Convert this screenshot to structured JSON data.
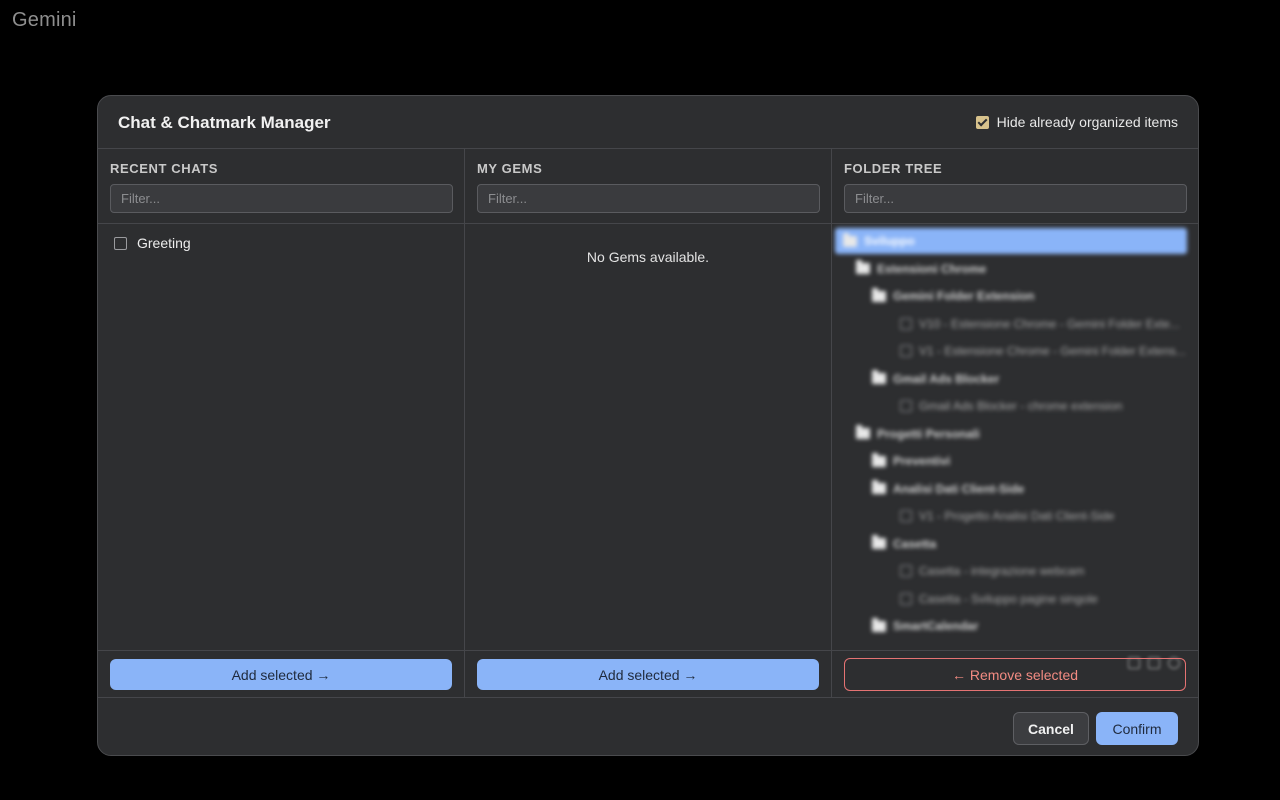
{
  "app": {
    "title": "Gemini"
  },
  "modal": {
    "title": "Chat & Chatmark Manager",
    "hide_organized_label": "Hide already organized items",
    "hide_organized_checked": true,
    "accent_color": "#8ab4f8",
    "danger_color": "#f28b82",
    "checkbox_color": "#d7c28c"
  },
  "recent_chats": {
    "title": "RECENT CHATS",
    "filter_placeholder": "Filter...",
    "items": [
      {
        "label": "Greeting",
        "checked": false
      }
    ],
    "add_button_label": "Add selected →"
  },
  "my_gems": {
    "title": "MY GEMS",
    "filter_placeholder": "Filter...",
    "empty_message": "No Gems available.",
    "add_button_label": "Add selected →"
  },
  "folder_tree": {
    "title": "FOLDER TREE",
    "filter_placeholder": "Filter...",
    "remove_button_label": "← Remove selected",
    "rows": [
      {
        "type": "folder",
        "label": "Sviluppo",
        "level": 0,
        "selected": true
      },
      {
        "type": "folder",
        "label": "Estensioni Chrome",
        "level": 1
      },
      {
        "type": "folder",
        "label": "Gemini Folder Extension",
        "level": 2
      },
      {
        "type": "chat",
        "label": "V10 - Estensione Chrome - Gemini Folder Exte...",
        "level": 3
      },
      {
        "type": "chat",
        "label": "V1 - Estensione Chrome - Gemini Folder Extens...",
        "level": 3
      },
      {
        "type": "folder",
        "label": "Gmail Ads Blocker",
        "level": 2
      },
      {
        "type": "chat",
        "label": "Gmail Ads Blocker - chrome extension",
        "level": 3
      },
      {
        "type": "folder",
        "label": "Progetti Personali",
        "level": 1
      },
      {
        "type": "folder",
        "label": "Preventivi",
        "level": 2
      },
      {
        "type": "folder",
        "label": "Analisi Dati Client-Side",
        "level": 2
      },
      {
        "type": "chat",
        "label": "V1 - Progetto Analisi Dati Client-Side",
        "level": 3
      },
      {
        "type": "folder",
        "label": "Casetta",
        "level": 2
      },
      {
        "type": "chat",
        "label": "Casetta - integrazione webcam",
        "level": 3
      },
      {
        "type": "chat",
        "label": "Casetta - Sviluppo pagine singole",
        "level": 3
      },
      {
        "type": "folder",
        "label": "SmartCalendar",
        "level": 2
      }
    ],
    "row_action_icons": [
      "edit-icon",
      "delete-icon",
      "add-icon"
    ]
  },
  "footer": {
    "cancel_label": "Cancel",
    "confirm_label": "Confirm"
  }
}
